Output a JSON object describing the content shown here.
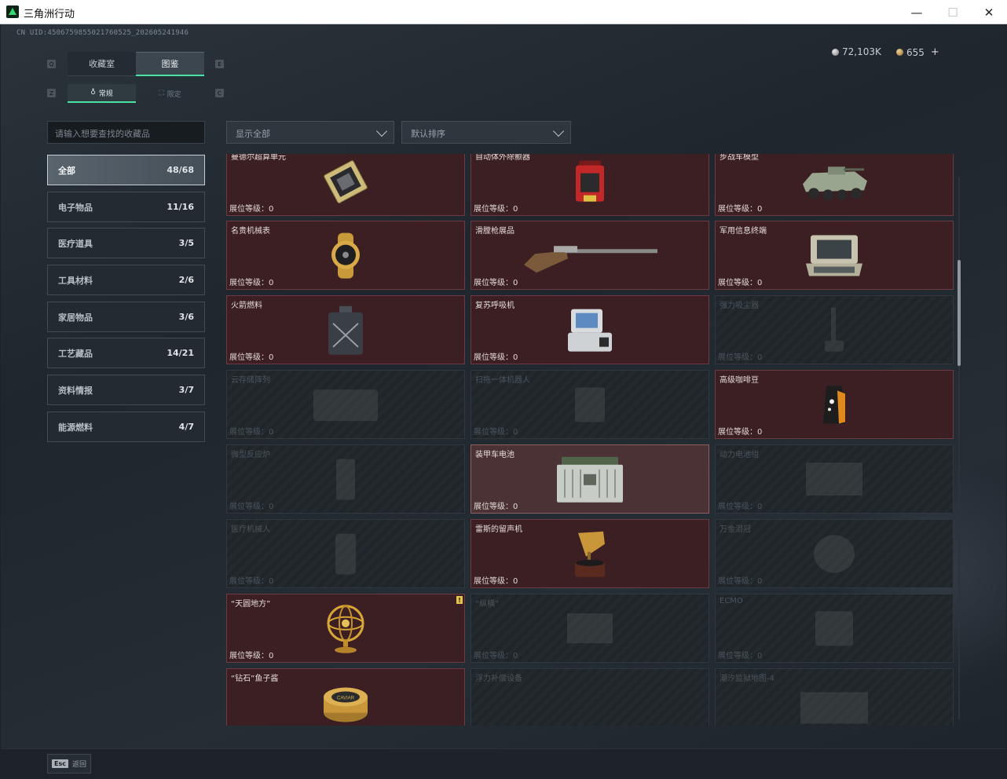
{
  "window": {
    "title": "三角洲行动",
    "min": "—",
    "max": "☐",
    "close": "✕"
  },
  "uid": "CN UID:4506759855021760525_202605241946",
  "currency": {
    "silver": "72,103K",
    "gold": "655",
    "plus": "+"
  },
  "key_hints": {
    "q": "Q",
    "e": "E",
    "z": "Z",
    "c": "C"
  },
  "tabs": [
    {
      "label": "收藏室",
      "active": false
    },
    {
      "label": "图鉴",
      "active": true
    }
  ],
  "subtabs": [
    {
      "icon": "♁",
      "label": "常规",
      "active": true
    },
    {
      "icon": "⛶",
      "label": "限定",
      "active": false
    }
  ],
  "search": {
    "placeholder": "请输入想要查找的收藏品"
  },
  "filters": {
    "show": "显示全部",
    "sort": "默认排序"
  },
  "categories": [
    {
      "label": "全部",
      "count": "48/68",
      "active": true
    },
    {
      "label": "电子物品",
      "count": "11/16",
      "active": false
    },
    {
      "label": "医疗道具",
      "count": "3/5",
      "active": false
    },
    {
      "label": "工具材料",
      "count": "2/6",
      "active": false
    },
    {
      "label": "家居物品",
      "count": "3/6",
      "active": false
    },
    {
      "label": "工艺藏品",
      "count": "14/21",
      "active": false
    },
    {
      "label": "资料情报",
      "count": "3/7",
      "active": false
    },
    {
      "label": "能源燃料",
      "count": "4/7",
      "active": false
    }
  ],
  "items": [
    {
      "name": "曼德尔超算单元",
      "level": "展位等级：0",
      "owned": true,
      "icon": "cpu-icon"
    },
    {
      "name": "自动体外除颤器",
      "level": "展位等级：0",
      "owned": true,
      "icon": "defibrillator-icon"
    },
    {
      "name": "步战车模型",
      "level": "展位等级：0",
      "owned": true,
      "icon": "ifv-model-icon"
    },
    {
      "name": "名贵机械表",
      "level": "展位等级：0",
      "owned": true,
      "icon": "watch-icon"
    },
    {
      "name": "滑膛枪展品",
      "level": "展位等级：0",
      "owned": true,
      "icon": "musket-icon"
    },
    {
      "name": "军用信息终端",
      "level": "展位等级：0",
      "owned": true,
      "icon": "terminal-icon"
    },
    {
      "name": "火箭燃料",
      "level": "展位等级：0",
      "owned": true,
      "icon": "fuel-can-icon"
    },
    {
      "name": "复苏呼吸机",
      "level": "展位等级：0",
      "owned": true,
      "icon": "ventilator-icon"
    },
    {
      "name": "强力吸尘器",
      "level": "展位等级：0",
      "owned": false,
      "icon": "vacuum-icon"
    },
    {
      "name": "云存储阵列",
      "level": "展位等级：0",
      "owned": false,
      "icon": "storage-array-icon"
    },
    {
      "name": "扫拖一体机器人",
      "level": "展位等级：0",
      "owned": false,
      "icon": "robot-vacuum-icon"
    },
    {
      "name": "高级咖啡豆",
      "level": "展位等级：0",
      "owned": true,
      "icon": "coffee-bag-icon"
    },
    {
      "name": "微型反应炉",
      "level": "展位等级：0",
      "owned": false,
      "icon": "reactor-icon"
    },
    {
      "name": "装甲车电池",
      "level": "展位等级：0",
      "owned": true,
      "selected": true,
      "icon": "battery-icon"
    },
    {
      "name": "动力电池组",
      "level": "展位等级：0",
      "owned": false,
      "icon": "battery-pack-icon"
    },
    {
      "name": "医疗机械人",
      "level": "展位等级：0",
      "owned": false,
      "icon": "medical-robot-icon"
    },
    {
      "name": "雷斯的留声机",
      "level": "展位等级：0",
      "owned": true,
      "icon": "gramophone-icon"
    },
    {
      "name": "万金泪冠",
      "level": "展位等级：0",
      "owned": false,
      "icon": "crown-icon"
    },
    {
      "name": "“天圆地方”",
      "level": "展位等级：0",
      "owned": true,
      "badge": "!",
      "icon": "armillary-icon"
    },
    {
      "name": "“纵横”",
      "level": "展位等级：0",
      "owned": false,
      "icon": "chessboard-icon"
    },
    {
      "name": "ECMO",
      "level": "展位等级：0",
      "owned": false,
      "icon": "ecmo-icon"
    },
    {
      "name": "“钻石”鱼子酱",
      "level": "",
      "owned": true,
      "icon": "caviar-icon"
    },
    {
      "name": "浮力补偿设备",
      "level": "",
      "owned": false,
      "icon": "bcd-icon"
    },
    {
      "name": "潮汐监狱地图-4",
      "level": "",
      "owned": false,
      "icon": "map-icon"
    }
  ],
  "caviar_label": "CAVIAR",
  "esc": {
    "key": "Esc",
    "label": "返回"
  },
  "colors": {
    "accent": "#49e2a2",
    "owned_card": "#3b1f23",
    "locked_card": "#1f2529"
  }
}
